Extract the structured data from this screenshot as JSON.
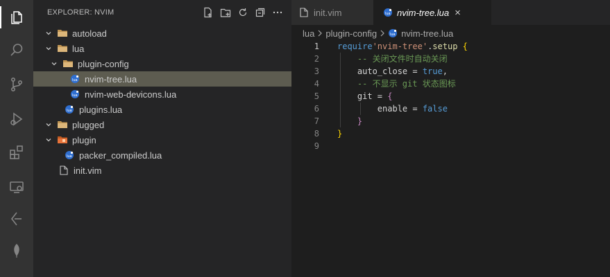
{
  "sidebar": {
    "title": "EXPLORER: NVIM",
    "actions": [
      "new-file-icon",
      "new-folder-icon",
      "refresh-icon",
      "collapse-all-icon",
      "more-icon"
    ],
    "tree": [
      {
        "label": "autoload",
        "type": "folder",
        "expanded": true
      },
      {
        "label": "lua",
        "type": "folder",
        "expanded": true
      },
      {
        "label": "plugin-config",
        "type": "folder",
        "expanded": true
      },
      {
        "label": "nvim-tree.lua",
        "type": "lua",
        "selected": true
      },
      {
        "label": "nvim-web-devicons.lua",
        "type": "lua"
      },
      {
        "label": "plugins.lua",
        "type": "lua"
      },
      {
        "label": "plugged",
        "type": "folder",
        "expanded": true
      },
      {
        "label": "plugin",
        "type": "folder-special",
        "expanded": true
      },
      {
        "label": "packer_compiled.lua",
        "type": "lua"
      },
      {
        "label": "init.vim",
        "type": "file"
      }
    ]
  },
  "tabs": [
    {
      "label": "init.vim",
      "active": false,
      "icon": "file-icon"
    },
    {
      "label": "nvim-tree.lua",
      "active": true,
      "icon": "lua-icon",
      "close": "×"
    }
  ],
  "breadcrumb": {
    "parts": [
      "lua",
      "plugin-config",
      "nvim-tree.lua"
    ]
  },
  "code": {
    "lines": [
      {
        "n": "1",
        "tokens": [
          {
            "t": "require",
            "c": "kw"
          },
          {
            "t": "'nvim-tree'",
            "c": "str"
          },
          {
            "t": ".",
            "c": "op"
          },
          {
            "t": "setup",
            "c": "fn"
          },
          {
            "t": " {",
            "c": "yel"
          }
        ]
      },
      {
        "n": "2",
        "tokens": [
          {
            "t": "    -- 关闭文件时自动关闭",
            "c": "cm"
          }
        ]
      },
      {
        "n": "3",
        "tokens": [
          {
            "t": "    auto_close ",
            "c": "op"
          },
          {
            "t": "=",
            "c": "op"
          },
          {
            "t": " true",
            "c": "kw"
          },
          {
            "t": ",",
            "c": "op"
          }
        ]
      },
      {
        "n": "4",
        "tokens": [
          {
            "t": "    -- 不显示 git 状态图标",
            "c": "cm"
          }
        ]
      },
      {
        "n": "5",
        "tokens": [
          {
            "t": "    git ",
            "c": "op"
          },
          {
            "t": "=",
            "c": "op"
          },
          {
            "t": " {",
            "c": "pur"
          }
        ]
      },
      {
        "n": "6",
        "tokens": [
          {
            "t": "        enable ",
            "c": "op"
          },
          {
            "t": "=",
            "c": "op"
          },
          {
            "t": " false",
            "c": "kw"
          }
        ]
      },
      {
        "n": "7",
        "tokens": [
          {
            "t": "    }",
            "c": "pur"
          }
        ]
      },
      {
        "n": "8",
        "tokens": [
          {
            "t": "}",
            "c": "yel"
          }
        ]
      },
      {
        "n": "9",
        "tokens": []
      }
    ]
  },
  "colors": {
    "selection": "#5d5c50",
    "accent_yellow": "#ffd700",
    "folder": "#dcb67a",
    "lua": "#2f6fd1"
  }
}
